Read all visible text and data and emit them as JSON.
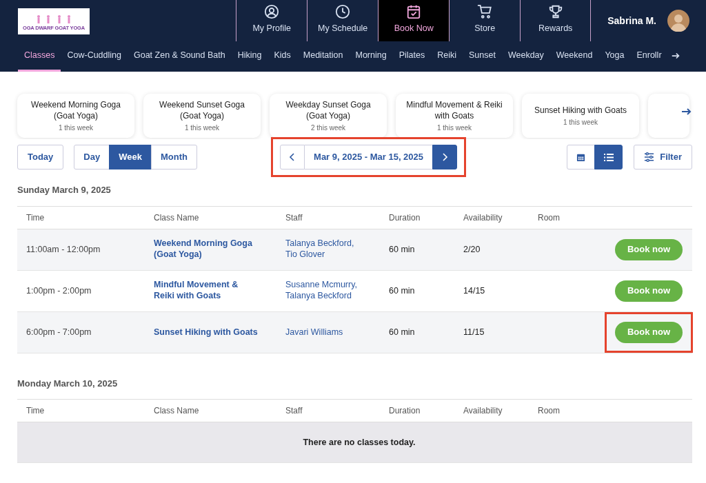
{
  "header": {
    "logo_text": "OGA DWARF GOAT YOGA",
    "nav": [
      {
        "label": "My Profile",
        "selected": false
      },
      {
        "label": "My Schedule",
        "selected": false
      },
      {
        "label": "Book Now",
        "selected": true
      },
      {
        "label": "Store",
        "selected": false
      },
      {
        "label": "Rewards",
        "selected": false
      }
    ],
    "user": {
      "name": "Sabrina M."
    }
  },
  "category_tabs": [
    {
      "label": "Classes",
      "selected": true
    },
    {
      "label": "Cow-Cuddling",
      "selected": false
    },
    {
      "label": "Goat Zen & Sound Bath",
      "selected": false
    },
    {
      "label": "Hiking",
      "selected": false
    },
    {
      "label": "Kids",
      "selected": false
    },
    {
      "label": "Meditation",
      "selected": false
    },
    {
      "label": "Morning",
      "selected": false
    },
    {
      "label": "Pilates",
      "selected": false
    },
    {
      "label": "Reiki",
      "selected": false
    },
    {
      "label": "Sunset",
      "selected": false
    },
    {
      "label": "Weekday",
      "selected": false
    },
    {
      "label": "Weekend",
      "selected": false
    },
    {
      "label": "Yoga",
      "selected": false
    },
    {
      "label": "Enrollr",
      "selected": false
    }
  ],
  "class_cards": [
    {
      "kind": "card",
      "title": "Weekend Morning Goga (Goat Yoga)",
      "count": "1 this week"
    },
    {
      "kind": "card",
      "title": "Weekend Sunset Goga (Goat Yoga)",
      "count": "1 this week"
    },
    {
      "kind": "card",
      "title": "Weekday Sunset Goga (Goat Yoga)",
      "count": "2 this week"
    },
    {
      "kind": "card",
      "title": "Mindful Movement & Reiki with Goats",
      "count": "1 this week"
    },
    {
      "kind": "card",
      "title": "Sunset Hiking with Goats",
      "count": "1 this week"
    },
    {
      "kind": "stub"
    }
  ],
  "controls": {
    "today": "Today",
    "views": [
      {
        "label": "Day",
        "selected": false
      },
      {
        "label": "Week",
        "selected": true
      },
      {
        "label": "Month",
        "selected": false
      }
    ],
    "date_range": {
      "label": "Mar 9, 2025 - Mar 15, 2025",
      "highlighted": true
    },
    "layouts": [
      {
        "selected": false
      },
      {
        "selected": true
      }
    ],
    "filter": "Filter"
  },
  "days": [
    {
      "heading": "Sunday March 9, 2025",
      "columns": [
        "Time",
        "Class Name",
        "Staff",
        "Duration",
        "Availability",
        "Room"
      ],
      "rows": [
        {
          "time": "11:00am - 12:00pm",
          "class_name": "Weekend Morning Goga (Goat Yoga)",
          "staff": "Talanya Beckford, Tio Glover",
          "duration": "60 min",
          "availability": "2/20",
          "button": "Book now",
          "highlighted": false
        },
        {
          "time": "1:00pm - 2:00pm",
          "class_name": "Mindful Movement & Reiki with Goats",
          "staff": "Susanne Mcmurry, Talanya Beckford",
          "duration": "60 min",
          "availability": "14/15",
          "button": "Book now",
          "highlighted": false
        },
        {
          "time": "6:00pm - 7:00pm",
          "class_name": "Sunset Hiking with Goats",
          "staff": "Javari Williams",
          "duration": "60 min",
          "availability": "11/15",
          "button": "Book now",
          "highlighted": true
        }
      ]
    },
    {
      "heading": "Monday March 10, 2025",
      "columns": [
        "Time",
        "Class Name",
        "Staff",
        "Duration",
        "Availability",
        "Room"
      ],
      "empty_message": "There are no classes today."
    }
  ]
}
